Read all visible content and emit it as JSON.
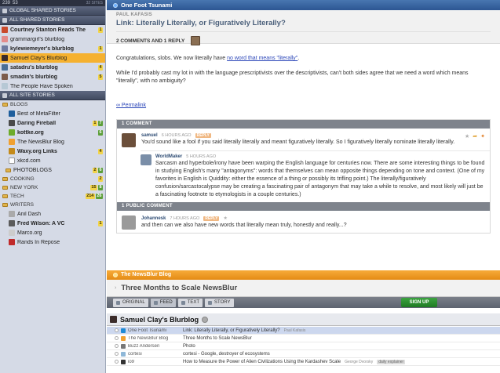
{
  "topbar": {
    "count_left": "239",
    "count_right": "53",
    "meta": "32 SITES"
  },
  "sidebar": {
    "global_shared": "GLOBAL SHARED STORIES",
    "all_shared": "ALL SHARED STORIES",
    "shared_feeds": [
      {
        "name": "Courtney Stanton Reads The",
        "y": "1",
        "g": "",
        "bold": true,
        "color": "#c94a2c",
        "selected": false
      },
      {
        "name": "grammargirl's blurblog",
        "y": "",
        "g": "",
        "bold": false,
        "color": "#e38b8b",
        "selected": false
      },
      {
        "name": "kylewiemeyer's blurblog",
        "y": "1",
        "g": "",
        "bold": true,
        "color": "#6e7aa0",
        "selected": false
      },
      {
        "name": "Samuel Clay's Blurblog",
        "y": "",
        "g": "",
        "bold": false,
        "color": "#3b2c2a",
        "selected": true
      },
      {
        "name": "satadru's blurblog",
        "y": "4",
        "g": "",
        "bold": true,
        "color": "#496e96",
        "selected": false
      },
      {
        "name": "smadin's blurblog",
        "y": "5",
        "g": "",
        "bold": true,
        "color": "#7c5b4a",
        "selected": false
      },
      {
        "name": "The People Have Spoken",
        "y": "",
        "g": "",
        "bold": false,
        "color": "#b6c8d5",
        "selected": false
      }
    ],
    "all_site": "ALL SITE STORIES",
    "folders": {
      "blogs": "BLOGS",
      "blog_feeds": [
        {
          "name": "Best of MetaFilter",
          "y": "",
          "g": "",
          "bold": false,
          "color": "#1e5e9c"
        },
        {
          "name": "Daring Fireball",
          "y": "1",
          "g": "7",
          "bold": true,
          "color": "#4a4a4a"
        },
        {
          "name": "kottke.org",
          "y": "",
          "g": "6",
          "bold": true,
          "color": "#6dab2a"
        },
        {
          "name": "The NewsBlur Blog",
          "y": "",
          "g": "",
          "bold": false,
          "color": "#f0a030"
        },
        {
          "name": "Waxy.org Links",
          "y": "4",
          "g": "",
          "bold": true,
          "color": "#c48a1a"
        },
        {
          "name": "xkcd.com",
          "y": "",
          "g": "",
          "bold": false,
          "color": "#ffffff"
        }
      ],
      "photoblogs": {
        "name": "PHOTOBLOGS",
        "y": "2",
        "g": "6"
      },
      "cooking": {
        "name": "COOKING",
        "y": "2",
        "g": ""
      },
      "newyork": {
        "name": "NEW YORK",
        "y": "15",
        "g": "8"
      },
      "tech": {
        "name": "TECH",
        "y": "214",
        "g": "26"
      },
      "writers": "WRITERS",
      "writer_feeds": [
        {
          "name": "Anil Dash",
          "y": "",
          "g": "",
          "bold": false,
          "color": "#aaaaaa"
        },
        {
          "name": "Fred Wilson: A VC",
          "y": "1",
          "g": "",
          "bold": true,
          "color": "#5b5b5b"
        },
        {
          "name": "Marco.org",
          "y": "",
          "g": "",
          "bold": false,
          "color": "#cccccc"
        },
        {
          "name": "Rands In Repose",
          "y": "",
          "g": "",
          "bold": false,
          "color": "#c02a2a"
        }
      ]
    }
  },
  "story": {
    "feed_title": "One Foot Tsunami",
    "author": "PAUL KAFASIS",
    "title": "Link: Literally Literally, or Figuratively Literally?",
    "comments_reply": "2 COMMENTS AND 1 REPLY",
    "p1_pre": "Congratulations, slobs. We now literally have ",
    "p1_link": "no word that means \"literally\"",
    "p1_post": ".",
    "p2": "While I'd probably cast my lot in with the language prescriptivists over the descriptivists, can't both sides agree that we need a word which means \"literally\", with no ambiguity?",
    "permalink": "∞ Permalink",
    "comment_header": "1 COMMENT",
    "comment": {
      "user": "samuel",
      "time": "6 HOURS AGO",
      "reply": "REPLY",
      "text": "You'd sound like a fool if you said literally literally and meant figuratively literally. So I figuratively literally nominate literally literally."
    },
    "reply": {
      "user": "WorldMaker",
      "time": "5 HOURS AGO",
      "text": "Sarcasm and hyperbole/irony have been warping the English language for centuries now. There are some interesting things to be found in studying English's many \"antagonyms\": words that themselves can mean opposite things depending on tone and context. (One of my favorites in English is Quiddity: either the essence of a thing or possibly its trifling point.) The literally/figuratively confusion/sarcastocalypse may be creating a fascinating pair of antagonym that may take a while to resolve, and most likely will just be a fascinating footnote to etymologists in a couple centuries.)"
    },
    "public_header": "1 PUBLIC COMMENT",
    "public": {
      "user": "Johannesk",
      "time": "7 HOURS AGO",
      "reply": "REPLY",
      "text": "and then can we also have new words that literally mean truly, honestly and really...?"
    }
  },
  "next_feed": {
    "title": "The NewsBlur Blog",
    "story_title": "Three Months to Scale NewsBlur"
  },
  "tabs": {
    "original": "ORIGINAL",
    "feed": "FEED",
    "text": "TEXT",
    "story": "STORY",
    "signup": "SIGN UP"
  },
  "feed_header": "Samuel Clay's Blurblog",
  "story_list": [
    {
      "feed": "One Foot Tsunami",
      "title": "Link: Literally Literally, or Figuratively Literally?",
      "author": "Paul Kafasis",
      "tag": "",
      "color": "#1e8ad6",
      "selected": true
    },
    {
      "feed": "The NewsBlur Blog",
      "title": "Three Months to Scale NewsBlur",
      "author": "",
      "tag": "",
      "color": "#f0a030",
      "selected": false
    },
    {
      "feed": "Buzz Andersen",
      "title": "Photo",
      "author": "",
      "tag": "",
      "color": "#777777",
      "selected": false
    },
    {
      "feed": "cortesi",
      "title": "cortesi - Google, destroyer of ecosystems",
      "author": "",
      "tag": "",
      "color": "#8fb8d8",
      "selected": false
    },
    {
      "feed": "io9",
      "title": "How to Measure the Power of Alien Civilizations Using the Kardashev Scale",
      "author": "George Dvorsky",
      "tag": "daily explainer",
      "color": "#333333",
      "selected": false
    }
  ]
}
